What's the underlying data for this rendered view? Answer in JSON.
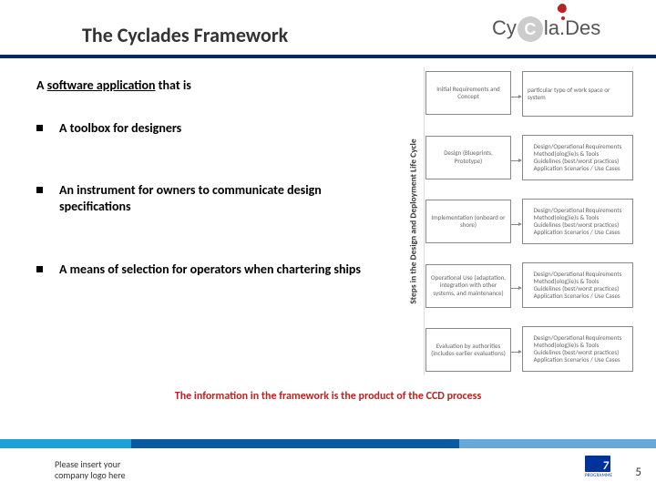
{
  "header": {
    "title": "The Cyclades Framework",
    "logo_text_1": "Cy",
    "logo_text_circ": "C",
    "logo_text_2": "la.Des"
  },
  "content": {
    "lead_prefix": "A ",
    "lead_underlined": "software application",
    "lead_suffix": " that is",
    "bullets": [
      "A toolbox for designers",
      "An instrument for owners to communicate design specifications",
      "A means of selection for operators when chartering ships"
    ]
  },
  "diagram": {
    "axis_label": "Steps in the Design and Deployment Life Cycle",
    "left_boxes": [
      "Initial Requirements and Concept",
      "Design (Blueprints, Prototype)",
      "Implementation (onboard or shore)",
      "Operational Use (adaptation, integration with other systems, and maintenance)",
      "Evaluation by authorities (includes earlier evaluations)"
    ],
    "right_box_top": "particular type of work space or system",
    "right_box_lines": [
      "Design/Operational Requirements",
      "Method(olog)ie)s & Tools",
      "Guidelines (best/worst practices)",
      "Application Scenarios / Use Cases"
    ]
  },
  "caption": "The information in the framework is the product of the CCD process",
  "footer": {
    "company_line1": "Please insert your",
    "company_line2": "company logo here",
    "fp7_caption": "PROGRAMME",
    "page_number": "5"
  }
}
